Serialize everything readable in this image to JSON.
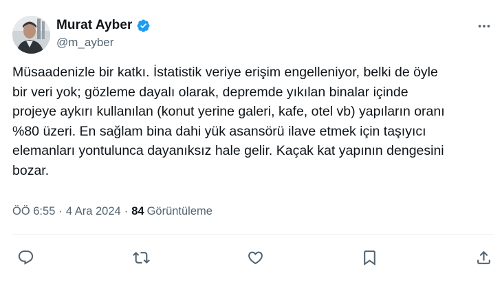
{
  "user": {
    "display_name": "Murat Ayber",
    "handle": "@m_ayber",
    "verified": true
  },
  "tweet": {
    "text": "Müsaadenizle bir katkı. İstatistik veriye erişim engelleniyor, belki de öyle\nbir veri yok; gözleme dayalı olarak, depremde yıkılan binalar içinde\nprojeye aykırı kullanılan (konut yerine galeri, kafe, otel vb) yapıların oranı\n%80 üzeri. En sağlam bina dahi yük asansörü ilave etmek için taşıyıcı\nelemanları yontulunca dayanıksız hale gelir. Kaçak kat yapının dengesini\nbozar.",
    "time": "ÖÖ 6:55",
    "separator": "·",
    "date": "4 Ara 2024",
    "views_count": "84",
    "views_label": "Görüntüleme"
  },
  "icons": {
    "more": "more-horizontal-icon",
    "reply": "reply-icon",
    "retweet": "retweet-icon",
    "like": "like-icon",
    "bookmark": "bookmark-icon",
    "share": "share-icon",
    "verified": "verified-badge-icon"
  },
  "colors": {
    "verified_blue": "#1d9bf0",
    "text_primary": "#0f1419",
    "text_secondary": "#536471",
    "divider": "#eff3f4"
  }
}
